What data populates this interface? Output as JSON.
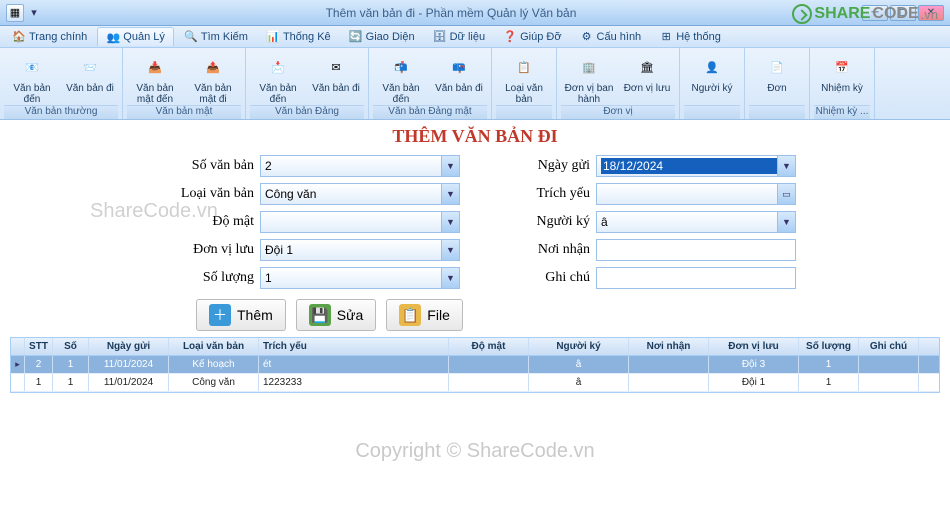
{
  "window": {
    "title": "Thêm văn bản đi - Phần mềm Quản lý Văn bản"
  },
  "watermarks": {
    "small": "ShareCode.vn",
    "large": "Copyright © ShareCode.vn",
    "brand_a": "SHARE",
    "brand_b": "CODE",
    "brand_ext": ".vn"
  },
  "menu": {
    "items": [
      {
        "label": "Trang chính",
        "icon": "🏠"
      },
      {
        "label": "Quản Lý",
        "icon": "👥",
        "active": true
      },
      {
        "label": "Tìm Kiếm",
        "icon": "🔍"
      },
      {
        "label": "Thống Kê",
        "icon": "📊"
      },
      {
        "label": "Giao Diện",
        "icon": "🔄"
      },
      {
        "label": "Dữ liệu",
        "icon": "🗄"
      },
      {
        "label": "Giúp Đỡ",
        "icon": "❓"
      },
      {
        "label": "Cấu hình",
        "icon": "⚙"
      },
      {
        "label": "Hệ thống",
        "icon": "⊞"
      }
    ]
  },
  "ribbon": {
    "groups": [
      {
        "label": "Văn bản thường",
        "buttons": [
          {
            "label": "Văn bản đến",
            "icon": "📧"
          },
          {
            "label": "Văn bản đi",
            "icon": "📨"
          }
        ]
      },
      {
        "label": "Văn bản mật",
        "buttons": [
          {
            "label": "Văn bản mật đến",
            "icon": "📥"
          },
          {
            "label": "Văn bản mật đi",
            "icon": "📤"
          }
        ]
      },
      {
        "label": "Văn bản Đảng",
        "buttons": [
          {
            "label": "Văn bản đến",
            "icon": "📩"
          },
          {
            "label": "Văn bản đi",
            "icon": "✉"
          }
        ]
      },
      {
        "label": "Văn bản Đảng mật",
        "buttons": [
          {
            "label": "Văn bản đến",
            "icon": "📬"
          },
          {
            "label": "Văn bản đi",
            "icon": "📪"
          }
        ]
      },
      {
        "label": "",
        "buttons": [
          {
            "label": "Loại văn bản",
            "icon": "📋"
          }
        ]
      },
      {
        "label": "Đơn vị",
        "buttons": [
          {
            "label": "Đơn vị ban hành",
            "icon": "🏢"
          },
          {
            "label": "Đơn vị lưu",
            "icon": "🏛"
          }
        ]
      },
      {
        "label": "",
        "buttons": [
          {
            "label": "Người ký",
            "icon": "👤"
          }
        ]
      },
      {
        "label": "",
        "buttons": [
          {
            "label": "Đơn",
            "icon": "📄"
          }
        ]
      },
      {
        "label": "Nhiệm kỳ ...",
        "buttons": [
          {
            "label": "Nhiệm kỳ",
            "icon": "📅"
          }
        ]
      }
    ]
  },
  "heading": "THÊM VĂN BẢN ĐI",
  "form": {
    "left": [
      {
        "label": "Số văn bản",
        "value": "2",
        "type": "combo"
      },
      {
        "label": "Loại văn bản",
        "value": "Công văn",
        "type": "combo"
      },
      {
        "label": "Độ mật",
        "value": "",
        "type": "combo"
      },
      {
        "label": "Đơn vị lưu",
        "value": "Đội 1",
        "type": "combo"
      },
      {
        "label": "Số lượng",
        "value": "1",
        "type": "combo"
      }
    ],
    "right": [
      {
        "label": "Ngày gửi",
        "value": "18/12/2024",
        "type": "date",
        "selected": true
      },
      {
        "label": "Trích yếu",
        "value": "",
        "type": "browse"
      },
      {
        "label": "Người ký",
        "value": "â",
        "type": "combo"
      },
      {
        "label": "Nơi nhận",
        "value": "",
        "type": "text"
      },
      {
        "label": "Ghi chú",
        "value": "",
        "type": "text"
      }
    ]
  },
  "actions": {
    "add": "Thêm",
    "edit": "Sửa",
    "file": "File"
  },
  "grid": {
    "headers": {
      "stt": "STT",
      "so": "Số",
      "ngay": "Ngày gửi",
      "loai": "Loại văn bản",
      "trich": "Trích yếu",
      "domat": "Độ mật",
      "nguoiky": "Người ký",
      "noinhan": "Nơi nhận",
      "donvi": "Đơn vị lưu",
      "sl": "Số lượng",
      "ghichu": "Ghi chú"
    },
    "rows": [
      {
        "stt": "2",
        "so": "1",
        "ngay": "11/01/2024",
        "loai": "Kế hoạch",
        "trich": "ét",
        "domat": "",
        "nguoiky": "â",
        "noinhan": "",
        "donvi": "Đội 3",
        "sl": "1",
        "ghichu": "",
        "selected": true
      },
      {
        "stt": "1",
        "so": "1",
        "ngay": "11/01/2024",
        "loai": "Công văn",
        "trich": "1223233",
        "domat": "",
        "nguoiky": "â",
        "noinhan": "",
        "donvi": "Đội 1",
        "sl": "1",
        "ghichu": ""
      }
    ]
  }
}
